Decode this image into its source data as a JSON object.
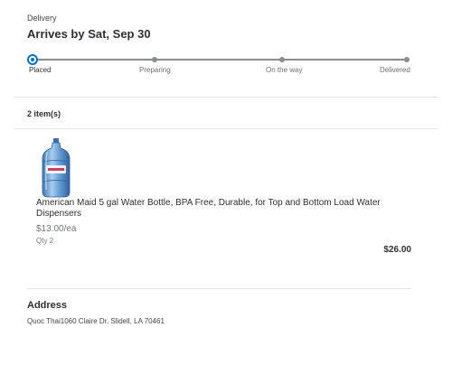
{
  "delivery": {
    "label": "Delivery",
    "title": "Arrives by Sat, Sep 30"
  },
  "tracker": {
    "steps": [
      {
        "label": "Placed",
        "state": "current"
      },
      {
        "label": "Preparing",
        "state": "pending"
      },
      {
        "label": "On the way",
        "state": "pending"
      },
      {
        "label": "Delivered",
        "state": "pending"
      }
    ],
    "accent_color": "#0071dc",
    "line_color": "#898b8f"
  },
  "items": {
    "count_label": "2 item(s)",
    "list": [
      {
        "image_icon": "water-bottle-image",
        "name": "American Maid 5 gal Water Bottle, BPA Free, Durable, for Top and Bottom Load Water Dispensers",
        "unit_price": "$13.00/ea",
        "quantity": "Qty 2",
        "total": "$26.00"
      }
    ]
  },
  "address": {
    "heading": "Address",
    "line": "Quoc Thai1060 Claire Dr, Slidell, LA 70461"
  }
}
